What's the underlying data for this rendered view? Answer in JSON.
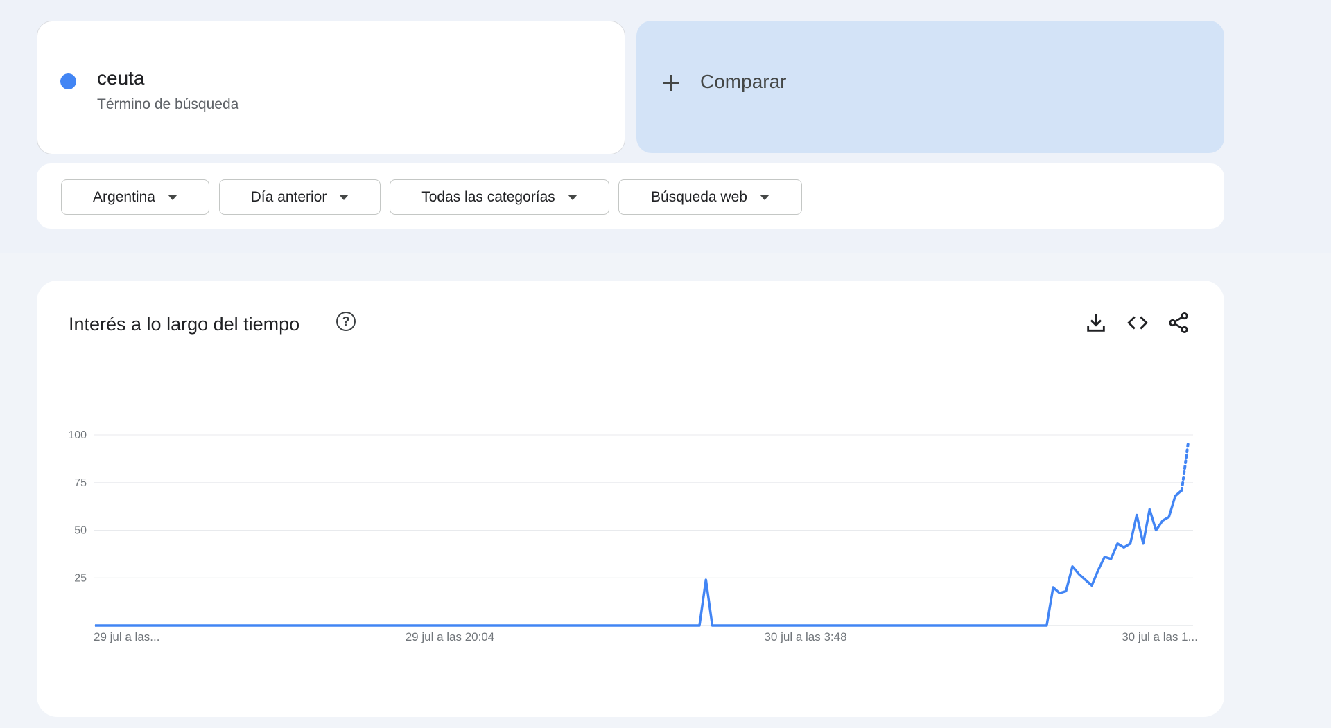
{
  "term": {
    "name": "ceuta",
    "type": "Término de búsqueda",
    "color": "#4285f4"
  },
  "compare": {
    "label": "Comparar",
    "icon": "plus-icon"
  },
  "filters": [
    {
      "label": "Argentina"
    },
    {
      "label": "Día anterior"
    },
    {
      "label": "Todas las categorías"
    },
    {
      "label": "Búsqueda web"
    }
  ],
  "chart": {
    "title": "Interés a lo largo del tiempo",
    "icons": [
      "help-icon",
      "download-icon",
      "embed-icon",
      "share-icon"
    ]
  },
  "chart_data": {
    "type": "line",
    "title": "Interés a lo largo del tiempo",
    "xlabel": "",
    "ylabel": "",
    "ylim": [
      0,
      100
    ],
    "yticks": [
      25,
      50,
      75,
      100
    ],
    "grid": true,
    "x_tick_labels": [
      "29 jul a las...",
      "29 jul a las 20:04",
      "30 jul a las 3:48",
      "30 jul a las 1..."
    ],
    "series": [
      {
        "color": "#4285f4",
        "values": [
          0,
          0,
          0,
          0,
          0,
          0,
          0,
          0,
          0,
          0,
          0,
          0,
          0,
          0,
          0,
          0,
          0,
          0,
          0,
          0,
          0,
          0,
          0,
          0,
          0,
          0,
          0,
          0,
          0,
          0,
          0,
          0,
          0,
          0,
          0,
          0,
          0,
          0,
          0,
          0,
          0,
          0,
          0,
          0,
          0,
          0,
          0,
          0,
          0,
          0,
          0,
          0,
          0,
          0,
          0,
          0,
          0,
          0,
          0,
          0,
          0,
          0,
          0,
          0,
          0,
          0,
          0,
          0,
          0,
          0,
          0,
          0,
          0,
          0,
          0,
          0,
          0,
          0,
          0,
          0,
          0,
          0,
          0,
          0,
          0,
          0,
          0,
          0,
          0,
          0,
          0,
          0,
          0,
          0,
          0,
          24,
          0,
          0,
          0,
          0,
          0,
          0,
          0,
          0,
          0,
          0,
          0,
          0,
          0,
          0,
          0,
          0,
          0,
          0,
          0,
          0,
          0,
          0,
          0,
          0,
          0,
          0,
          0,
          0,
          0,
          0,
          0,
          0,
          0,
          0,
          0,
          0,
          0,
          0,
          0,
          0,
          0,
          0,
          0,
          0,
          0,
          0,
          0,
          0,
          0,
          0,
          0,
          0,
          0,
          20,
          17,
          18,
          31,
          27,
          24,
          21,
          29,
          36,
          35,
          43,
          41,
          43,
          58,
          43,
          61,
          50,
          55,
          57,
          68,
          71
        ],
        "partial_last": 96
      }
    ]
  }
}
